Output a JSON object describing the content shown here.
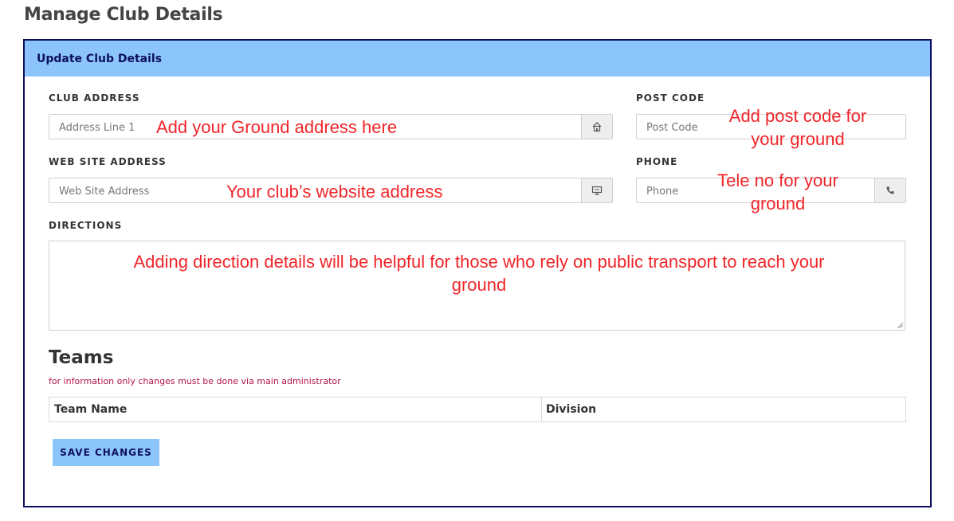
{
  "page": {
    "title": "Manage Club Details"
  },
  "panel": {
    "title": "Update Club Details"
  },
  "fields": {
    "club_address": {
      "label": "CLUB ADDRESS",
      "placeholder": "Address Line 1",
      "icon": "house-icon"
    },
    "post_code": {
      "label": "POST CODE",
      "placeholder": "Post Code"
    },
    "website": {
      "label": "WEB SITE ADDRESS",
      "placeholder": "Web Site Address",
      "icon": "monitor-icon"
    },
    "phone": {
      "label": "PHONE",
      "placeholder": "Phone",
      "icon": "phone-icon"
    },
    "directions": {
      "label": "DIRECTIONS"
    }
  },
  "annotations": {
    "address": "Add your Ground address here",
    "post_code_1": "Add post code for",
    "post_code_2": "your ground",
    "website": "Your club’s website address",
    "phone_1": "Tele no for your",
    "phone_2": "ground",
    "directions_1": "Adding direction details will be helpful for those who rely on public transport to reach your",
    "directions_2": "ground"
  },
  "teams": {
    "title": "Teams",
    "note": "for information only changes must be done via main administrator",
    "columns": [
      "Team Name",
      "Division"
    ]
  },
  "actions": {
    "save_label": "SAVE CHANGES"
  },
  "colors": {
    "header_bg": "#8cc5fb",
    "border_navy": "#0d1060",
    "annotation_red": "#f0262a",
    "note_crimson": "#b3164a"
  }
}
